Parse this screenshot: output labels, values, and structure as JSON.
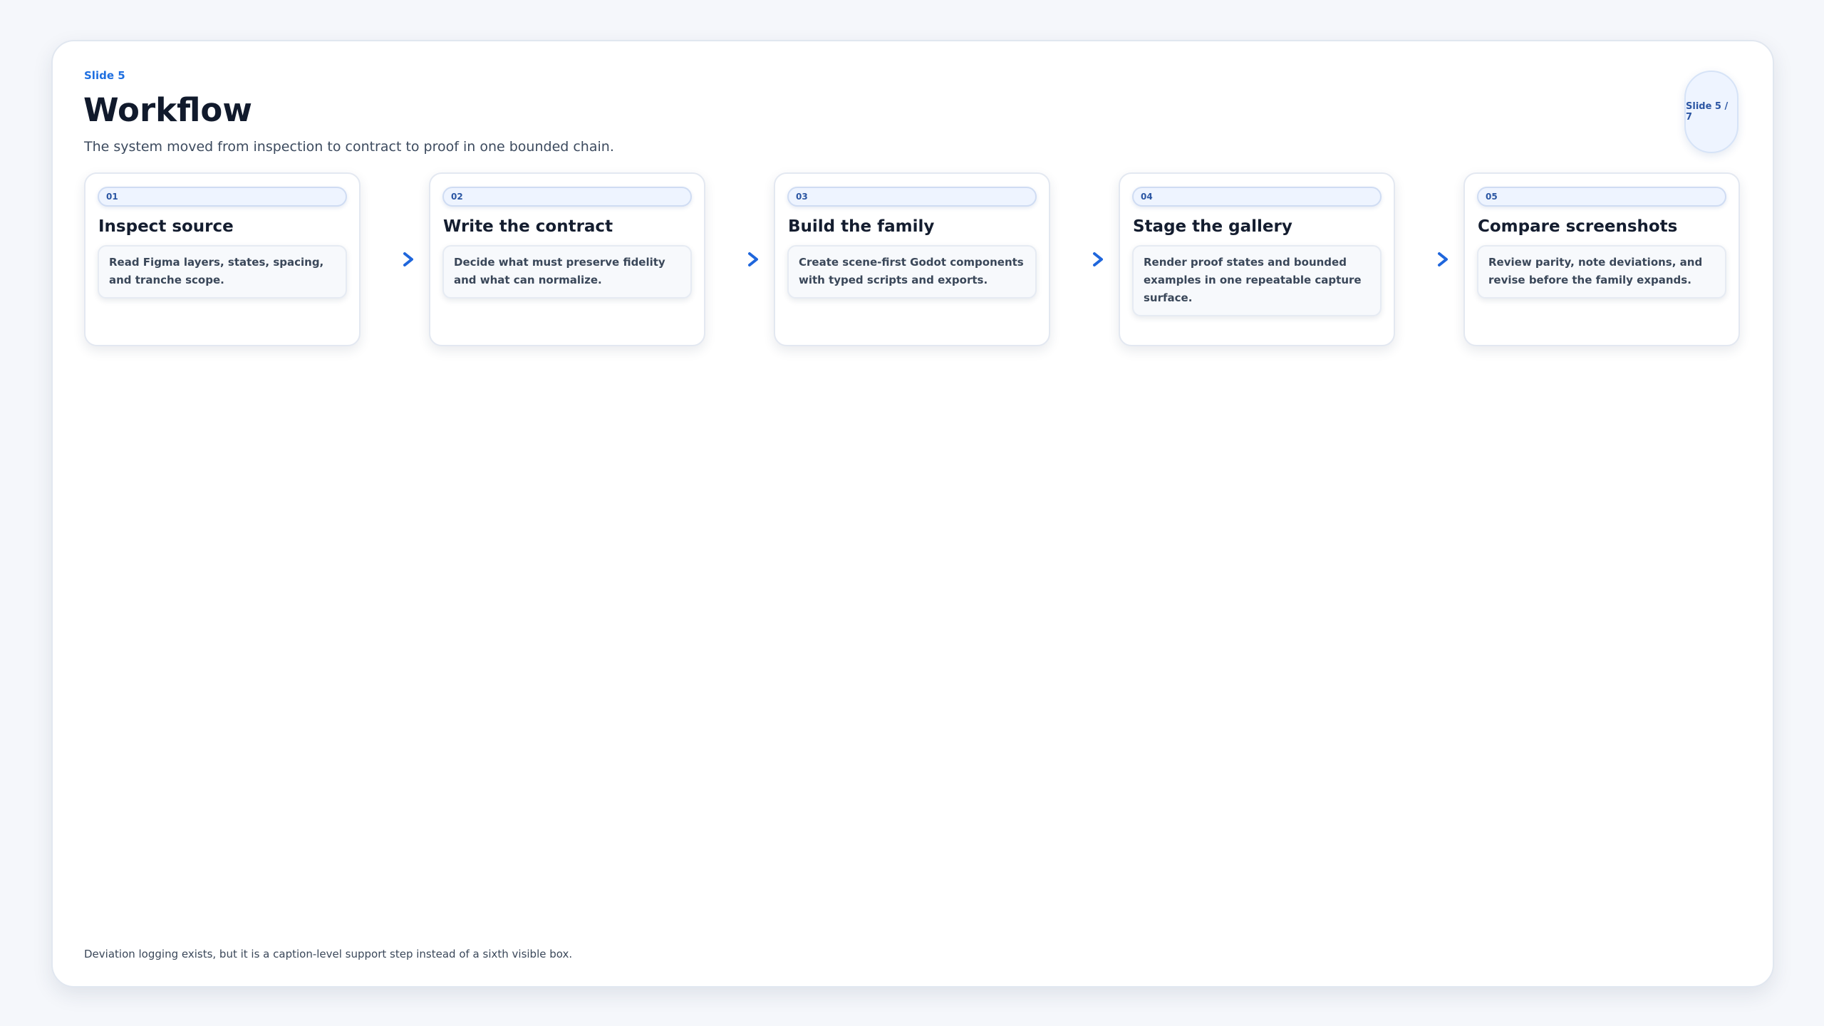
{
  "slide": {
    "eyebrow": "Slide 5",
    "title": "Workflow",
    "subtitle": "The system moved from inspection to contract to proof in one bounded chain.",
    "counter": "Slide 5 / 7",
    "footnote": "Deviation logging exists, but it is a caption-level support step instead of a sixth visible box."
  },
  "steps": [
    {
      "number": "01",
      "title": "Inspect source",
      "description": "Read Figma layers, states, spacing, and tranche scope."
    },
    {
      "number": "02",
      "title": "Write the contract",
      "description": "Decide what must preserve fidelity and what can normalize."
    },
    {
      "number": "03",
      "title": "Build the family",
      "description": "Create scene-first Godot components with typed scripts and exports."
    },
    {
      "number": "04",
      "title": "Stage the gallery",
      "description": "Render proof states and bounded examples in one repeatable capture surface."
    },
    {
      "number": "05",
      "title": "Compare screenshots",
      "description": "Review parity, note deviations, and revise before the family expands."
    }
  ],
  "colors": {
    "accent": "#1f6fe0",
    "title_text": "#111a2c",
    "body_text": "#3a4759",
    "badge_bg": "#eef4ff",
    "page_bg": "#f5f7fb"
  },
  "icons": {
    "connector": "arrow-right-icon"
  }
}
